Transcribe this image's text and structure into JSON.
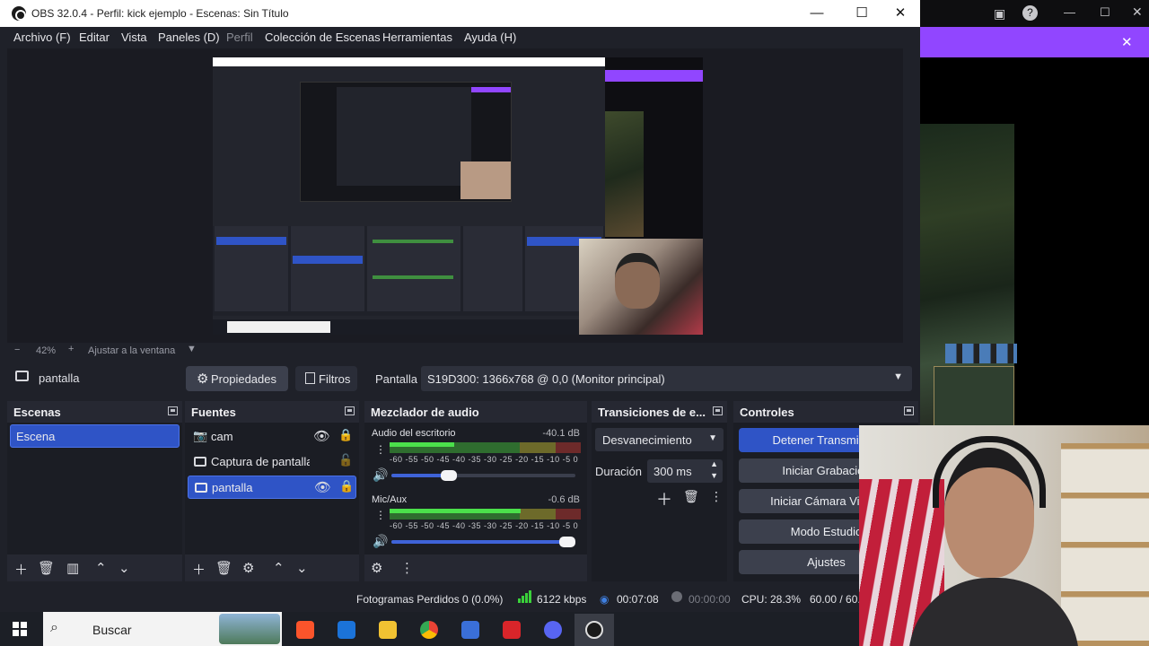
{
  "window": {
    "title": "OBS 32.0.4 - Perfil: kick ejemplo - Escenas: Sin Título"
  },
  "menu": [
    "Archivo (F)",
    "Editar",
    "Vista",
    "Paneles (D)",
    "Perfil",
    "Colección de Escenas",
    "Herramientas",
    "Ayuda (H)"
  ],
  "preview": {
    "zoom": "42%",
    "fit_label": "Ajustar a la ventana"
  },
  "context": {
    "source_name": "pantalla",
    "properties_label": "Propiedades",
    "filters_label": "Filtros",
    "display_label": "Pantalla",
    "display_value": "S19D300: 1366x768 @ 0,0 (Monitor principal)"
  },
  "scenes": {
    "title": "Escenas",
    "items": [
      "Escena"
    ]
  },
  "sources": {
    "title": "Fuentes",
    "items": [
      {
        "label": "cam",
        "icon": "camera-icon",
        "locked": true
      },
      {
        "label": "Captura de pantalla",
        "icon": "monitor-icon",
        "locked": false
      },
      {
        "label": "pantalla",
        "icon": "monitor-icon",
        "locked": true
      }
    ]
  },
  "audio": {
    "title": "Mezclador de audio",
    "channels": [
      {
        "name": "Audio del escritorio",
        "db": "-40.1 dB",
        "volume_fraction": 0.32
      },
      {
        "name": "Mic/Aux",
        "db": "-0.6 dB",
        "volume_fraction": 0.97
      }
    ],
    "scale": "-60 -55 -50 -45 -40 -35 -30 -25 -20 -15 -10 -5 0"
  },
  "transitions": {
    "title": "Transiciones de e...",
    "type": "Desvanecimiento",
    "duration_label": "Duración",
    "duration_value": "300 ms"
  },
  "controls": {
    "title": "Controles",
    "buttons": [
      "Detener Transmisión",
      "Iniciar Grabación",
      "Iniciar Cámara Virtual",
      "Modo Estudio",
      "Ajustes"
    ]
  },
  "status": {
    "dropped": "Fotogramas Perdidos 0 (0.0%)",
    "bitrate": "6122 kbps",
    "stream_time": "00:07:08",
    "rec_time": "00:00:00",
    "cpu": "CPU: 28.3%",
    "fps": "60.00 / 60.00 FPS"
  },
  "taskbar": {
    "search_placeholder": "Buscar"
  },
  "colors": {
    "accent": "#2f54c6",
    "twitch_purple": "#9146ff",
    "panel_bg": "#1b1d24"
  }
}
